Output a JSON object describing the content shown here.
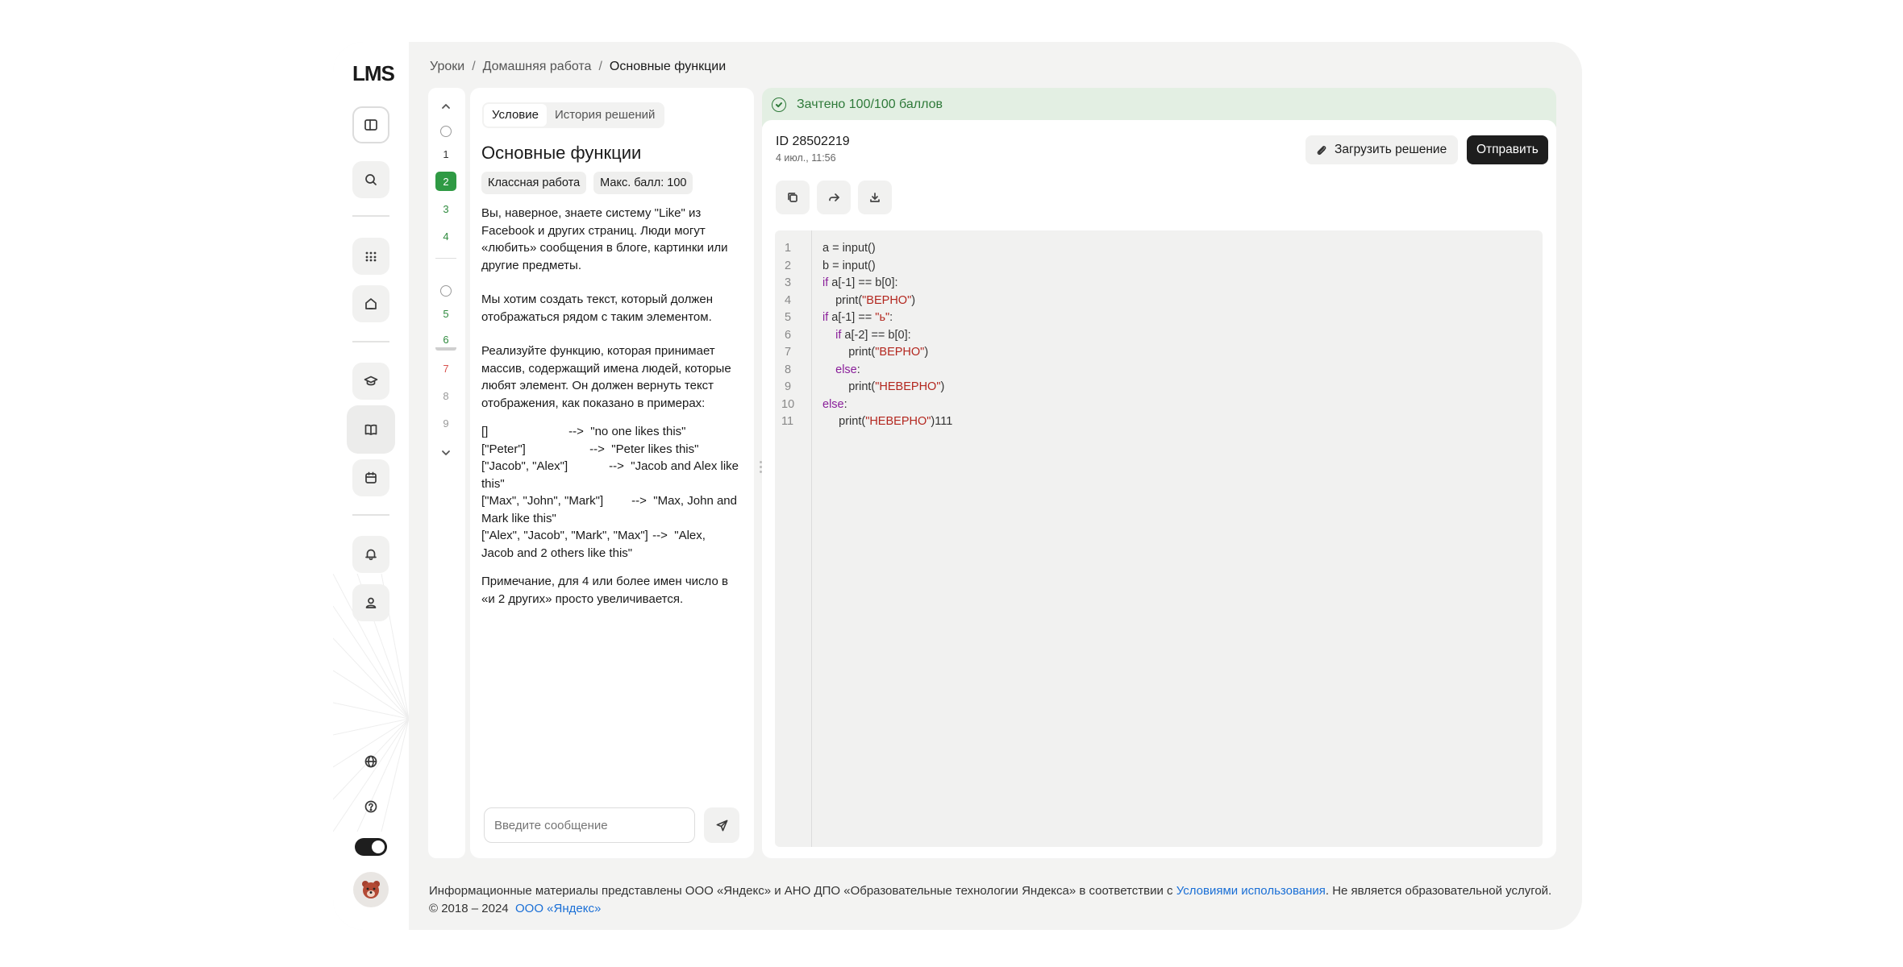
{
  "app": {
    "logo": "LMS"
  },
  "breadcrumbs": [
    "Уроки",
    "Домашняя работа",
    "Основные функции"
  ],
  "rail": {
    "icons": [
      "sidebar-toggle-icon",
      "search-icon",
      "apps-grid-icon",
      "home-icon",
      "graduation-cap-icon",
      "book-icon",
      "calendar-icon",
      "bell-icon",
      "user-icon",
      "globe-icon",
      "help-icon",
      "theme-toggle",
      "avatar"
    ]
  },
  "tasks": {
    "items": [
      {
        "label": "1",
        "state": "plain"
      },
      {
        "label": "2",
        "state": "active"
      },
      {
        "label": "3",
        "state": "done"
      },
      {
        "label": "4",
        "state": "done"
      },
      {
        "label": "5",
        "state": "done"
      },
      {
        "label": "6",
        "state": "current"
      },
      {
        "label": "7",
        "state": "failed"
      },
      {
        "label": "8",
        "state": "new"
      },
      {
        "label": "9",
        "state": "new"
      }
    ],
    "colors": {
      "done": "#2f8a3e",
      "active_bg": "#2f9a44",
      "failed": "#d9534f",
      "new": "#999999"
    }
  },
  "condition": {
    "tabs": [
      "Условие",
      "История решений"
    ],
    "title": "Основные функции",
    "chips": [
      "Классная работа",
      "Макс. балл: 100"
    ],
    "paragraphs": [
      "Вы, наверное, знаете систему \"Like\" из Facebook и других страниц. Люди могут «любить» сообщения в блоге, картинки или другие предметы.",
      "Мы хотим создать текст, который должен отображаться рядом с таким элементом.",
      "Реализуйте функцию, которая принимает массив, содержащий имена людей, которые любят элемент. Он должен вернуть текст отображения, как показано в примерах:"
    ],
    "examples": [
      {
        "input": "[]",
        "output": "\"no one likes this\""
      },
      {
        "input": "[\"Peter\"]",
        "output": "\"Peter likes this\""
      },
      {
        "input": "[\"Jacob\", \"Alex\"]",
        "output": "\"Jacob and Alex like this\""
      },
      {
        "input": "[\"Max\", \"John\", \"Mark\"]",
        "output": "\"Max, John and Mark like this\""
      },
      {
        "input": "[\"Alex\", \"Jacob\", \"Mark\", \"Max\"]",
        "output": "\"Alex, Jacob and 2 others like this\""
      }
    ],
    "arrow": "-->",
    "note": "Примечание, для 4 или более имен число в «и 2 других» просто увеличивается.",
    "chat_placeholder": "Введите сообщение"
  },
  "solution": {
    "status": "Зачтено 100/100 баллов",
    "status_color": "#2f7a3a",
    "id": "ID 28502219",
    "date": "4 июл., 11:56",
    "upload_label": "Загрузить решение",
    "submit_label": "Отправить",
    "code": [
      "a = input()",
      "b = input()",
      "if a[-1] == b[0]:",
      "    print(\"ВЕРНО\")",
      "if a[-1] == \"ь\":",
      "    if a[-2] == b[0]:",
      "        print(\"ВЕРНО\")",
      "    else:",
      "        print(\"НЕВЕРНО\")",
      "else:",
      "     print(\"НЕВЕРНО\")111"
    ]
  },
  "footer": {
    "text_before": "Информационные материалы представлены ООО «Яндекс» и АНО ДПО «Образовательные технологии Яндекса» в соответствии с ",
    "terms_link": "Условиями использования",
    "text_after": ". Не является образовательной услугой.",
    "copyright": "© 2018 – 2024",
    "company_link": "ООО «Яндекс»"
  }
}
